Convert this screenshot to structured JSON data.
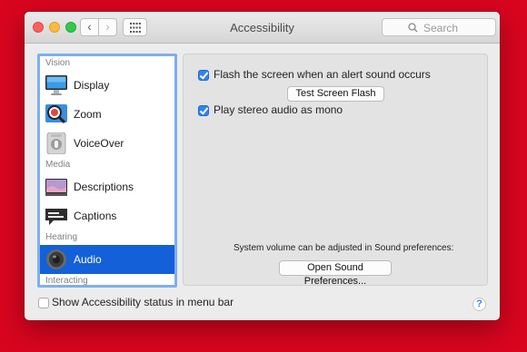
{
  "window": {
    "title": "Accessibility"
  },
  "toolbar": {
    "back": "‹",
    "forward": "›",
    "grid_icon": "grid-icon"
  },
  "search": {
    "placeholder": "Search"
  },
  "sidebar": {
    "sections": [
      {
        "header": "Vision",
        "items": [
          {
            "label": "Display",
            "icon": "display-icon"
          },
          {
            "label": "Zoom",
            "icon": "zoom-icon"
          },
          {
            "label": "VoiceOver",
            "icon": "voiceover-icon"
          }
        ]
      },
      {
        "header": "Media",
        "items": [
          {
            "label": "Descriptions",
            "icon": "descriptions-icon"
          },
          {
            "label": "Captions",
            "icon": "captions-icon"
          }
        ]
      },
      {
        "header": "Hearing",
        "items": [
          {
            "label": "Audio",
            "icon": "speaker-icon",
            "selected": true
          }
        ]
      },
      {
        "header": "Interacting",
        "items": []
      }
    ]
  },
  "panel": {
    "flash_label": "Flash the screen when an alert sound occurs",
    "flash_checked": true,
    "test_button": "Test Screen Flash",
    "mono_label": "Play stereo audio as mono",
    "mono_checked": true,
    "volume_note": "System volume can be adjusted in Sound preferences:",
    "sound_button": "Open Sound Preferences..."
  },
  "footer": {
    "status_label": "Show Accessibility status in menu bar",
    "status_checked": false,
    "help": "?"
  },
  "colors": {
    "selection": "#1360d8",
    "checkbox": "#2f83f4",
    "background": "#d9051f"
  }
}
